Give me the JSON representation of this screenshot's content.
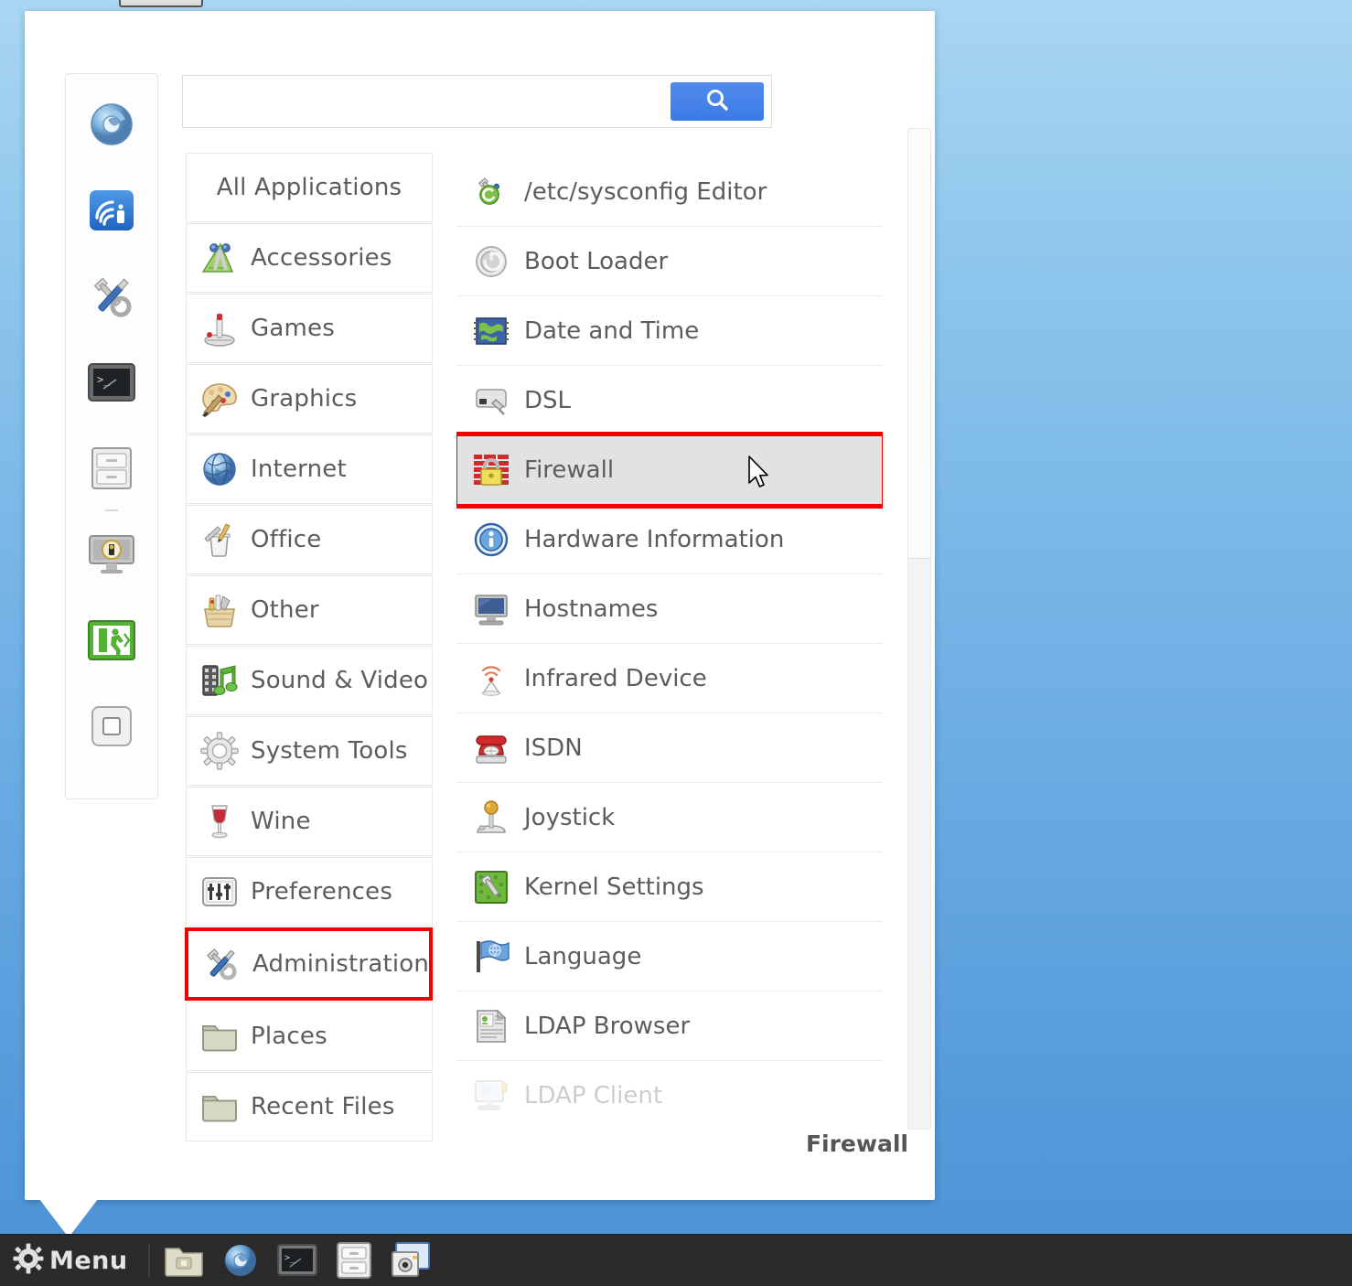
{
  "desktop": {
    "background_top": "#a9d6f2",
    "background_bottom": "#4b90d4"
  },
  "menu_popup": {
    "search": {
      "value": "",
      "placeholder": "",
      "button_icon": "search-icon",
      "button_color": "#4178e3"
    },
    "categories": [
      {
        "label": "All Applications",
        "icon": "none",
        "centered": true,
        "marked": false
      },
      {
        "label": "Accessories",
        "icon": "accessories-icon",
        "centered": false,
        "marked": false
      },
      {
        "label": "Games",
        "icon": "games-joystick-icon",
        "centered": false,
        "marked": false
      },
      {
        "label": "Graphics",
        "icon": "graphics-palette-icon",
        "centered": false,
        "marked": false
      },
      {
        "label": "Internet",
        "icon": "internet-globe-icon",
        "centered": false,
        "marked": false
      },
      {
        "label": "Office",
        "icon": "office-icon",
        "centered": false,
        "marked": false
      },
      {
        "label": "Other",
        "icon": "other-basket-icon",
        "centered": false,
        "marked": false
      },
      {
        "label": "Sound & Video",
        "icon": "sound-video-icon",
        "centered": false,
        "marked": false
      },
      {
        "label": "System Tools",
        "icon": "system-tools-gear-icon",
        "centered": false,
        "marked": false
      },
      {
        "label": "Wine",
        "icon": "wine-glass-icon",
        "centered": false,
        "marked": false
      },
      {
        "label": "Preferences",
        "icon": "preferences-sliders-icon",
        "centered": false,
        "marked": false
      },
      {
        "label": "Administration",
        "icon": "administration-tools-icon",
        "centered": false,
        "marked": true
      },
      {
        "label": "Places",
        "icon": "folder-icon",
        "centered": false,
        "marked": false
      },
      {
        "label": "Recent Files",
        "icon": "folder-icon",
        "centered": false,
        "marked": false
      }
    ],
    "applications": [
      {
        "label": "/etc/sysconfig Editor",
        "icon": "sysconfig-editor-icon",
        "selected": false,
        "marked": false,
        "faded": false
      },
      {
        "label": "Boot Loader",
        "icon": "power-boot-icon",
        "selected": false,
        "marked": false,
        "faded": false
      },
      {
        "label": "Date and Time",
        "icon": "date-time-chip-icon",
        "selected": false,
        "marked": false,
        "faded": false
      },
      {
        "label": "DSL",
        "icon": "dsl-modem-icon",
        "selected": false,
        "marked": false,
        "faded": false
      },
      {
        "label": "Firewall",
        "icon": "firewall-brickwall-lock-icon",
        "selected": true,
        "marked": true,
        "faded": false
      },
      {
        "label": "Hardware Information",
        "icon": "info-circle-icon",
        "selected": false,
        "marked": false,
        "faded": false
      },
      {
        "label": "Hostnames",
        "icon": "computer-monitor-icon",
        "selected": false,
        "marked": false,
        "faded": false
      },
      {
        "label": "Infrared Device",
        "icon": "infrared-signal-icon",
        "selected": false,
        "marked": false,
        "faded": false
      },
      {
        "label": "ISDN",
        "icon": "isdn-telephone-icon",
        "selected": false,
        "marked": false,
        "faded": false
      },
      {
        "label": "Joystick",
        "icon": "joystick-icon",
        "selected": false,
        "marked": false,
        "faded": false
      },
      {
        "label": "Kernel Settings",
        "icon": "kernel-chip-wrench-icon",
        "selected": false,
        "marked": false,
        "faded": false
      },
      {
        "label": "Language",
        "icon": "language-flag-icon",
        "selected": false,
        "marked": false,
        "faded": false
      },
      {
        "label": "LDAP Browser",
        "icon": "ldap-browser-document-icon",
        "selected": false,
        "marked": false,
        "faded": false
      },
      {
        "label": "LDAP Client",
        "icon": "ldap-client-monitor-icon",
        "selected": false,
        "marked": false,
        "faded": true
      }
    ],
    "status_text": "Firewall",
    "highlight_color": "#f30000",
    "selection_color": "#e2e2e2",
    "rail_icons": [
      "web-browser-icon",
      "network-wireless-icon",
      "settings-tools-icon",
      "terminal-icon",
      "file-manager-icon",
      "separator",
      "lock-screen-icon",
      "logout-icon",
      "shutdown-icon"
    ],
    "scrollbar": {
      "thumb_position_percent": 0,
      "thumb_size_percent": 43
    }
  },
  "taskbar": {
    "menu_label": "Menu",
    "menu_icon": "gear-icon",
    "launchers": [
      "file-manager-folder-icon",
      "web-browser-icon",
      "terminal-icon",
      "archive-manager-icon",
      "screenshot-tool-icon"
    ]
  }
}
